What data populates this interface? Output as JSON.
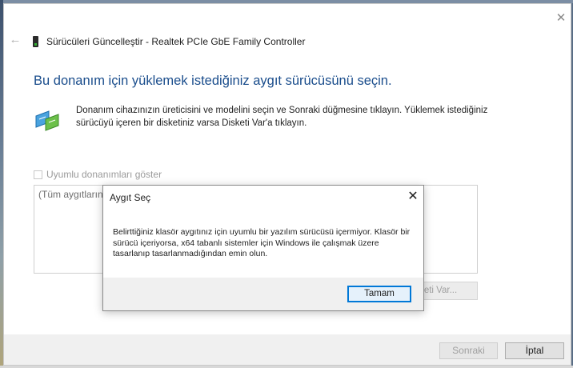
{
  "wizard": {
    "back_icon": "back-arrow-icon",
    "close_icon": "close-icon",
    "title_icon": "network-device-icon",
    "title": "Sürücüleri Güncelleştir - Realtek PCIe GbE Family Controller",
    "heading": "Bu donanım için yüklemek istediğiniz aygıt sürücüsünü seçin.",
    "instruction_icon": "network-adapter-icon",
    "instructions": "Donanım cihazınızın üreticisini ve modelini seçin ve Sonraki düğmesine tıklayın. Yüklemek istediğiniz sürücüyü içeren bir disketiniz varsa Disketi Var'a tıklayın.",
    "compatible_checkbox": {
      "label": "Uyumlu donanımları göster",
      "checked": false,
      "enabled": false
    },
    "list_visible_text": "(Tüm aygıtların",
    "have_disk_visible_text": "eti Var...",
    "next_label": "Sonraki",
    "cancel_label": "İptal"
  },
  "modal": {
    "title": "Aygıt Seç",
    "close_icon": "close-icon",
    "message": "Belirttiğiniz klasör aygıtınız için uyumlu bir yazılım sürücüsü içermiyor. Klasör bir sürücü içeriyorsa, x64 tabanlı sistemler için Windows ile çalışmak üzere tasarlanıp tasarlanmadığından emin olun.",
    "ok_label": "Tamam"
  },
  "colors": {
    "heading_blue": "#1a4d8c",
    "focus_blue": "#0078d7",
    "footer_gray": "#f0f0f0"
  }
}
